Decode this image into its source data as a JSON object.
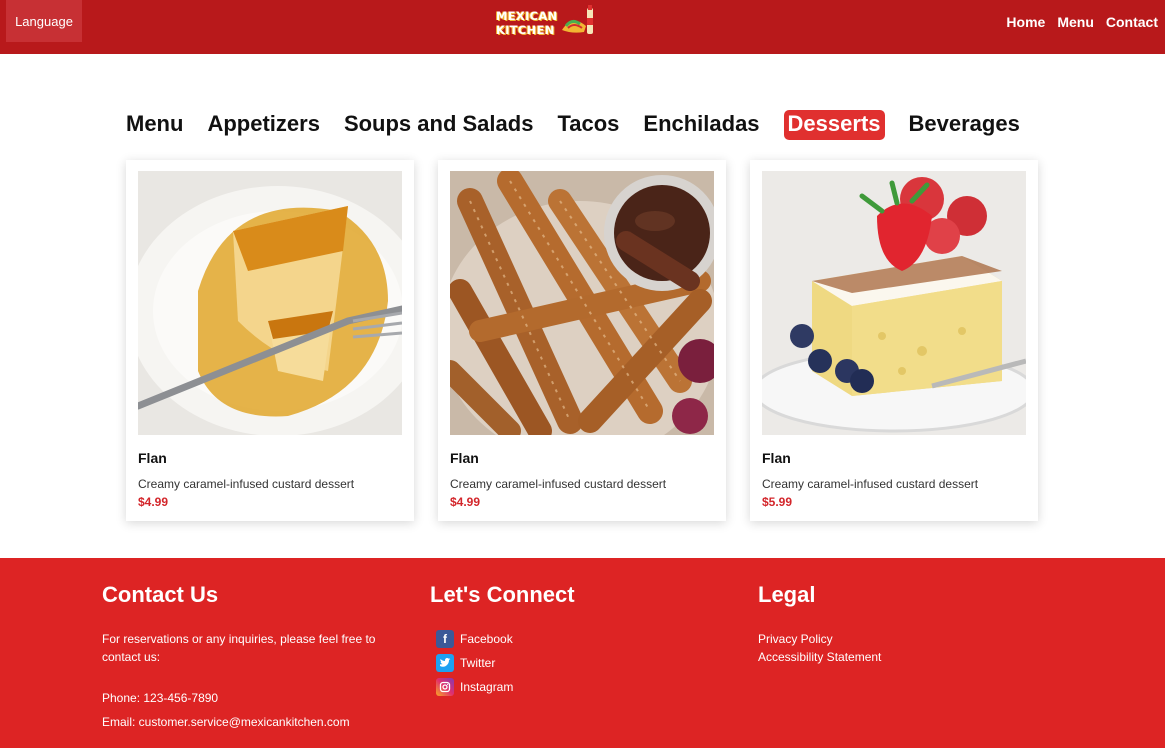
{
  "header": {
    "language_label": "Language",
    "logo_text_line1": "MEXICAN",
    "logo_text_line2": "KITCHEN",
    "nav": [
      "Home",
      "Menu",
      "Contact"
    ]
  },
  "tabs": [
    "Menu",
    "Appetizers",
    "Soups and Salads",
    "Tacos",
    "Enchiladas",
    "Desserts",
    "Beverages"
  ],
  "active_tab": "Desserts",
  "cards": [
    {
      "name": "Flan",
      "description": "Creamy caramel-infused custard dessert",
      "price": "$4.99",
      "image": "flan-image"
    },
    {
      "name": "Flan",
      "description": "Creamy caramel-infused custard dessert",
      "price": "$4.99",
      "image": "churros-image"
    },
    {
      "name": "Flan",
      "description": "Creamy caramel-infused custard dessert",
      "price": "$5.99",
      "image": "tres-leches-image"
    }
  ],
  "footer": {
    "contact": {
      "title": "Contact Us",
      "text": "For reservations or any inquiries, please feel free to contact us:",
      "phone": "Phone: 123-456-7890",
      "email": "Email: customer.service@mexicankitchen.com"
    },
    "connect": {
      "title": "Let's Connect",
      "links": [
        {
          "label": "Facebook",
          "icon": "facebook-icon",
          "color": "#3b5998"
        },
        {
          "label": "Twitter",
          "icon": "twitter-icon",
          "color": "#1da1f2"
        },
        {
          "label": "Instagram",
          "icon": "instagram-icon",
          "color": "#c13584"
        }
      ]
    },
    "legal": {
      "title": "Legal",
      "links": [
        "Privacy Policy",
        "Accessibility Statement"
      ]
    }
  },
  "colors": {
    "header_bg": "#b8191b",
    "footer_bg": "#dd2424",
    "active_tab": "#e0302f",
    "price": "#d3262b"
  }
}
